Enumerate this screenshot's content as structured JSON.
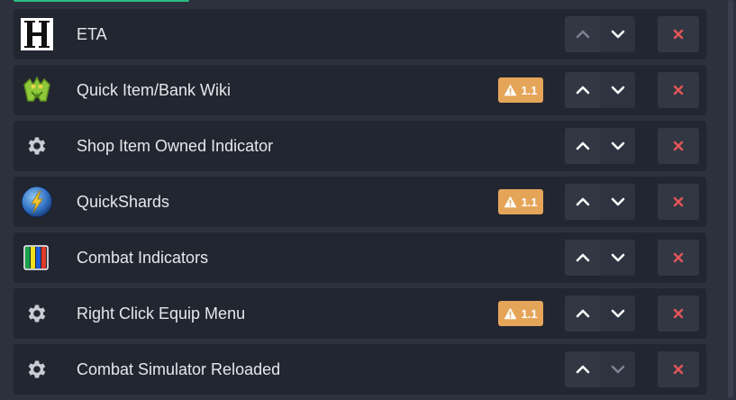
{
  "plugins": [
    {
      "name": "ETA",
      "icon": "eta-logo-icon",
      "warning": null,
      "up_enabled": false,
      "down_enabled": true
    },
    {
      "name": "Quick Item/Bank Wiki",
      "icon": "wiki-mascot-icon",
      "warning": "1.1",
      "up_enabled": true,
      "down_enabled": true
    },
    {
      "name": "Shop Item Owned Indicator",
      "icon": "gear-icon",
      "warning": null,
      "up_enabled": true,
      "down_enabled": true
    },
    {
      "name": "QuickShards",
      "icon": "lightning-orb-icon",
      "warning": "1.1",
      "up_enabled": true,
      "down_enabled": true
    },
    {
      "name": "Combat Indicators",
      "icon": "color-bars-icon",
      "warning": null,
      "up_enabled": true,
      "down_enabled": true
    },
    {
      "name": "Right Click Equip Menu",
      "icon": "gear-icon",
      "warning": "1.1",
      "up_enabled": true,
      "down_enabled": true
    },
    {
      "name": "Combat Simulator Reloaded",
      "icon": "gear-icon",
      "warning": null,
      "up_enabled": true,
      "down_enabled": false
    }
  ],
  "colors": {
    "background": "#2c313d",
    "row": "#222631",
    "warning_badge": "#e5a559",
    "remove_x": "#e05555",
    "chevron_enabled": "#ffffff",
    "chevron_disabled": "#7c8290"
  }
}
